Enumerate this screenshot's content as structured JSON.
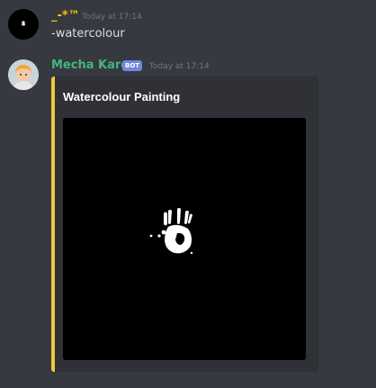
{
  "messages": [
    {
      "username": "_-*™",
      "timestamp": "Today at 17:14",
      "content": "-watercolour",
      "avatar_icon": "black-avatar-icon"
    },
    {
      "username": "Mecha Karen",
      "badge": "BOT",
      "timestamp": "Today at 17:14",
      "avatar_icon": "cartoon-girl-avatar-icon",
      "embed": {
        "title": "Watercolour Painting",
        "accent_color": "#f4c542",
        "image_icon": "handprint-painting-icon"
      }
    }
  ],
  "colors": {
    "background": "#36393f",
    "embed_background": "#2f3136",
    "username_1": "#f1c40f",
    "username_2": "#43b581",
    "badge": "#7289da"
  }
}
